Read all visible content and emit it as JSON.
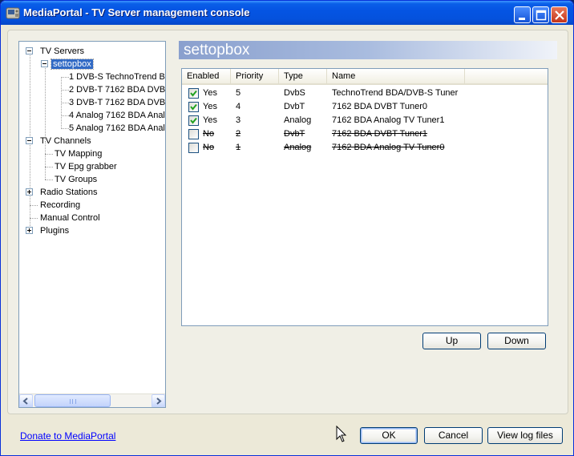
{
  "window": {
    "title": "MediaPortal - TV Server management console"
  },
  "tree": {
    "tv_servers": "TV Servers",
    "server": "settopbox",
    "cards": [
      "1 DVB-S TechnoTrend B",
      "2 DVB-T 7162 BDA DVB",
      "3 DVB-T 7162 BDA DVB",
      "4 Analog 7162 BDA Anal",
      "5 Analog 7162 BDA Anal"
    ],
    "tv_channels": "TV Channels",
    "channel_items": [
      "TV Mapping",
      "TV Epg grabber",
      "TV Groups"
    ],
    "radio_stations": "Radio Stations",
    "recording": "Recording",
    "manual_control": "Manual Control",
    "plugins": "Plugins"
  },
  "header": {
    "title": "settopbox"
  },
  "cards_table": {
    "columns": [
      "Enabled",
      "Priority",
      "Type",
      "Name"
    ],
    "rows": [
      {
        "enabled": "Yes",
        "checked": true,
        "priority": "5",
        "type": "DvbS",
        "name": "TechnoTrend BDA/DVB-S Tuner"
      },
      {
        "enabled": "Yes",
        "checked": true,
        "priority": "4",
        "type": "DvbT",
        "name": "7162 BDA DVBT Tuner0"
      },
      {
        "enabled": "Yes",
        "checked": true,
        "priority": "3",
        "type": "Analog",
        "name": "7162 BDA Analog TV Tuner1"
      },
      {
        "enabled": "No",
        "checked": false,
        "priority": "2",
        "type": "DvbT",
        "name": "7162 BDA DVBT Tuner1"
      },
      {
        "enabled": "No",
        "checked": false,
        "priority": "1",
        "type": "Analog",
        "name": "7162 BDA Analog TV Tuner0"
      }
    ]
  },
  "buttons": {
    "up": "Up",
    "down": "Down",
    "ok": "OK",
    "cancel": "Cancel",
    "view_log": "View log files"
  },
  "links": {
    "donate": "Donate to MediaPortal"
  },
  "colors": {
    "title_bar": "#0554e3",
    "selection": "#316ac5",
    "link": "#0000ff"
  }
}
